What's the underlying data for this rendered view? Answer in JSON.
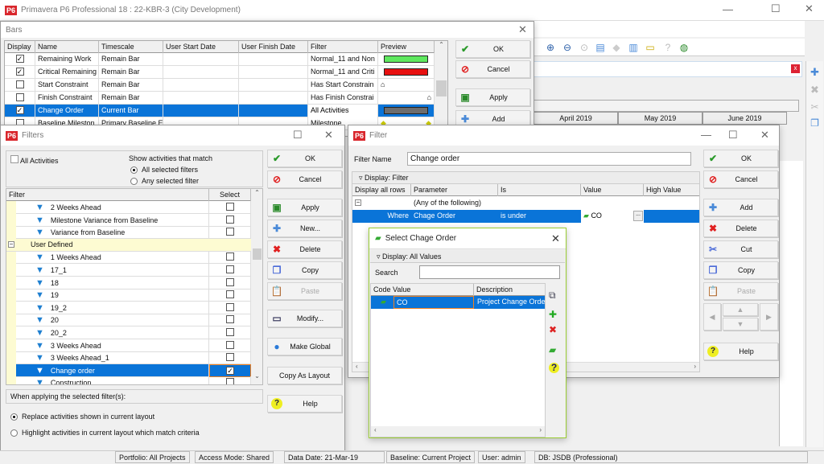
{
  "app": {
    "title": "Primavera P6 Professional 18 : 22-KBR-3 (City Development)",
    "logo": "P6"
  },
  "timescale": {
    "months": [
      "April 2019",
      "May 2019",
      "June 2019"
    ]
  },
  "toolbar": {
    "icons": [
      "zoom-in-icon",
      "zoom-out-icon",
      "zoom-fit-icon",
      "split-horizontal-icon",
      "diamond-icon",
      "columns-icon",
      "comment-icon",
      "help-gray-icon",
      "globe-help-icon"
    ]
  },
  "bars": {
    "title": "Bars",
    "columns": [
      "Display",
      "Name",
      "Timescale",
      "User Start Date",
      "User Finish Date",
      "Filter",
      "Preview"
    ],
    "rows": [
      {
        "display": true,
        "name": "Remaining Work",
        "timescale": "Remain Bar",
        "filter": "Normal_11 and Non",
        "preview": "bar",
        "color": "#5fe85f"
      },
      {
        "display": true,
        "name": "Critical Remaining",
        "timescale": "Remain Bar",
        "filter": "Normal_11 and Criti",
        "preview": "bar",
        "color": "#e81010"
      },
      {
        "display": false,
        "name": "Start Constraint",
        "timescale": "Remain Bar",
        "filter": "Has Start Constrain",
        "preview": "start-constraint"
      },
      {
        "display": false,
        "name": "Finish Constraint",
        "timescale": "Remain Bar",
        "filter": "Has Finish Constrai",
        "preview": "finish-constraint"
      },
      {
        "display": true,
        "name": "Change Order",
        "timescale": "Current Bar",
        "filter": "All Activities",
        "preview": "bar",
        "color": "#6d6d6d",
        "selected": true
      },
      {
        "display": false,
        "name": "Baseline Mileston",
        "timescale": "Primary Baseline E",
        "filter": "Milestone",
        "preview": "diamonds"
      }
    ],
    "buttons": [
      "OK",
      "Cancel",
      "Apply",
      "Add"
    ]
  },
  "filters": {
    "title": "Filters",
    "all_activities": "All Activities",
    "match_label": "Show activities that match",
    "match_options": [
      "All selected filters",
      "Any selected filter"
    ],
    "columns": [
      "Filter",
      "Select"
    ],
    "rows": [
      {
        "name": "2 Weeks Ahead",
        "checked": false
      },
      {
        "name": "Milestone Variance from Baseline",
        "checked": false
      },
      {
        "name": "Variance from Baseline",
        "checked": false
      },
      {
        "group": "User Defined"
      },
      {
        "name": "1 Weeks Ahead",
        "checked": false
      },
      {
        "name": "17_1",
        "checked": false
      },
      {
        "name": "18",
        "checked": false
      },
      {
        "name": "19",
        "checked": false
      },
      {
        "name": "19_2",
        "checked": false
      },
      {
        "name": "20",
        "checked": false
      },
      {
        "name": "20_2",
        "checked": false
      },
      {
        "name": "3 Weeks Ahead",
        "checked": false
      },
      {
        "name": "3 Weeks Ahead_1",
        "checked": false
      },
      {
        "name": "Change order",
        "checked": true,
        "selected": true
      },
      {
        "name": "Construction",
        "checked": false
      }
    ],
    "apply_label": "When applying the selected filter(s):",
    "apply_options": [
      "Replace activities shown in current layout",
      "Highlight activities in current layout which match criteria"
    ],
    "buttons": [
      "OK",
      "Cancel",
      "Apply",
      "New...",
      "Delete",
      "Copy",
      "Paste",
      "Modify...",
      "Make Global",
      "Copy As Layout",
      "Help"
    ]
  },
  "filter": {
    "title": "Filter",
    "name_label": "Filter Name",
    "name_value": "Change order",
    "display_bar": "Display: Filter",
    "columns": [
      "Display all rows",
      "Parameter",
      "Is",
      "Value",
      "High Value"
    ],
    "group_row": "(Any of the following)",
    "criteria": {
      "where": "Where",
      "parameter": "Chage Order",
      "is": "is under",
      "value": "CO",
      "high_value": ""
    },
    "buttons": [
      "OK",
      "Cancel",
      "Add",
      "Delete",
      "Cut",
      "Copy",
      "Paste",
      "Help"
    ]
  },
  "select_code": {
    "title": "Select Chage Order",
    "display_bar": "Display: All Values",
    "search_label": "Search",
    "search_value": "",
    "columns": [
      "Code Value",
      "Description"
    ],
    "rows": [
      {
        "code": "CO",
        "description": "Project Change Order"
      }
    ]
  },
  "status": {
    "portfolio": "Portfolio: All Projects",
    "access": "Access Mode: Shared",
    "data_date": "Data Date: 21-Mar-19",
    "baseline": "Baseline: Current Project",
    "user": "User: admin",
    "db": "DB: JSDB (Professional)"
  }
}
